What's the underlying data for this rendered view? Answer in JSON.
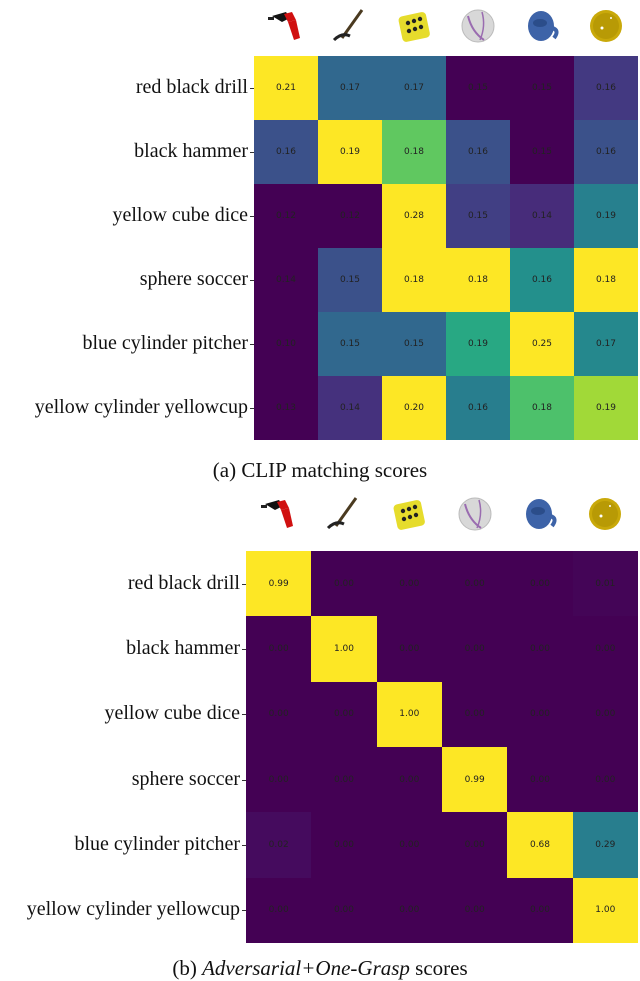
{
  "chart_data": [
    {
      "type": "heatmap",
      "title": "(a) CLIP matching scores",
      "caption": "(a) CLIP matching scores",
      "row_labels": [
        "red black drill",
        "black hammer",
        "yellow cube dice",
        "sphere soccer",
        "blue cylinder pitcher",
        "yellow cylinder yellowcup"
      ],
      "column_icons": [
        "drill-icon",
        "hammer-icon",
        "dice-icon",
        "soccer-ball-icon",
        "pitcher-icon",
        "yellow-cup-icon"
      ],
      "values": [
        [
          0.21,
          0.17,
          0.17,
          0.15,
          0.15,
          0.16
        ],
        [
          0.16,
          0.19,
          0.18,
          0.16,
          0.15,
          0.16
        ],
        [
          0.12,
          0.12,
          0.28,
          0.15,
          0.14,
          0.19
        ],
        [
          0.14,
          0.15,
          0.18,
          0.18,
          0.16,
          0.18
        ],
        [
          0.1,
          0.15,
          0.15,
          0.19,
          0.25,
          0.17
        ],
        [
          0.13,
          0.14,
          0.2,
          0.16,
          0.18,
          0.19
        ]
      ],
      "colormap": "viridis",
      "normalization": "per-row"
    },
    {
      "type": "heatmap",
      "title": "(b) Adversarial+One-Grasp scores",
      "caption_prefix": "(b) ",
      "caption_italic": "Adversarial+One-Grasp",
      "caption_suffix": " scores",
      "row_labels": [
        "red black drill",
        "black hammer",
        "yellow cube dice",
        "sphere soccer",
        "blue cylinder pitcher",
        "yellow cylinder yellowcup"
      ],
      "column_icons": [
        "drill-icon",
        "hammer-icon",
        "dice-icon",
        "soccer-ball-icon",
        "pitcher-icon",
        "yellow-cup-icon"
      ],
      "values": [
        [
          0.99,
          0.0,
          0.0,
          0.0,
          0.0,
          0.01
        ],
        [
          0.0,
          1.0,
          0.0,
          0.0,
          0.0,
          0.0
        ],
        [
          0.0,
          0.0,
          1.0,
          0.0,
          0.0,
          0.0
        ],
        [
          0.0,
          0.0,
          0.0,
          0.99,
          0.0,
          0.0
        ],
        [
          0.02,
          0.0,
          0.0,
          0.0,
          0.68,
          0.29
        ],
        [
          0.0,
          0.0,
          0.0,
          0.0,
          0.0,
          1.0
        ]
      ],
      "colormap": "viridis",
      "normalization": "per-row"
    }
  ]
}
